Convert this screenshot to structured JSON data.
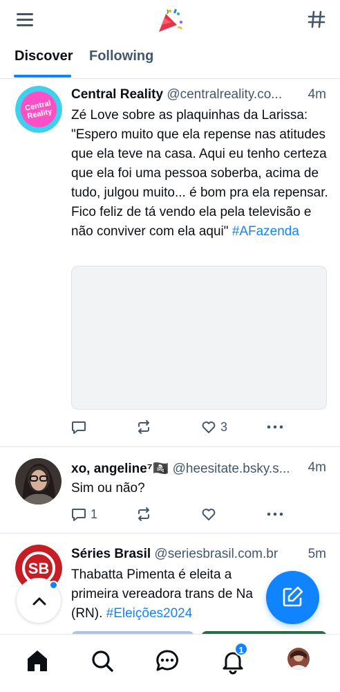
{
  "header": {
    "menu_icon": "hamburger-menu-icon",
    "logo_icon": "party-popper-logo",
    "feeds_icon": "hashtag-icon"
  },
  "tabs": [
    {
      "label": "Discover",
      "active": true
    },
    {
      "label": "Following",
      "active": false
    }
  ],
  "posts": [
    {
      "author": "Central Reality",
      "handle": "@centralreality.co...",
      "time": "4m",
      "text": "Zé Love sobre as plaquinhas da Larissa: \"Espero muito que ela repense nas atitudes que ela teve na casa. Aqui eu tenho certeza que ela foi uma pessoa soberba, acima de tudo, julgou muito... é bom pra ela repensar. Fico feliz de tá vendo ela pela televisão e não conviver com ela aqui\" ",
      "hashtag": "#AFazenda",
      "avatar_text": "Central Reality",
      "reply_count": "",
      "repost_count": "",
      "like_count": "3"
    },
    {
      "author": "xo, angeline⁷🏴‍☠️",
      "handle": "@heesitate.bsky.s...",
      "time": "4m",
      "text": "Sim ou não?",
      "hashtag": "",
      "reply_count": "1",
      "repost_count": "",
      "like_count": ""
    },
    {
      "author": "Séries Brasil",
      "handle": "@seriesbrasil.com.br",
      "time": "5m",
      "text": "Thabatta Pimenta é eleita a primeira vereadora trans de Na (RN). ",
      "hashtag": "#Eleições2024",
      "avatar_text": "SB"
    }
  ],
  "bottom_nav": {
    "items": [
      "home-icon",
      "search-icon",
      "chat-icon",
      "notifications-icon",
      "profile-avatar"
    ],
    "notification_badge": "1"
  },
  "colors": {
    "accent": "#1083fe",
    "text_primary": "#0b0f14",
    "text_secondary": "#42576c",
    "divider": "#e4e8ec"
  }
}
